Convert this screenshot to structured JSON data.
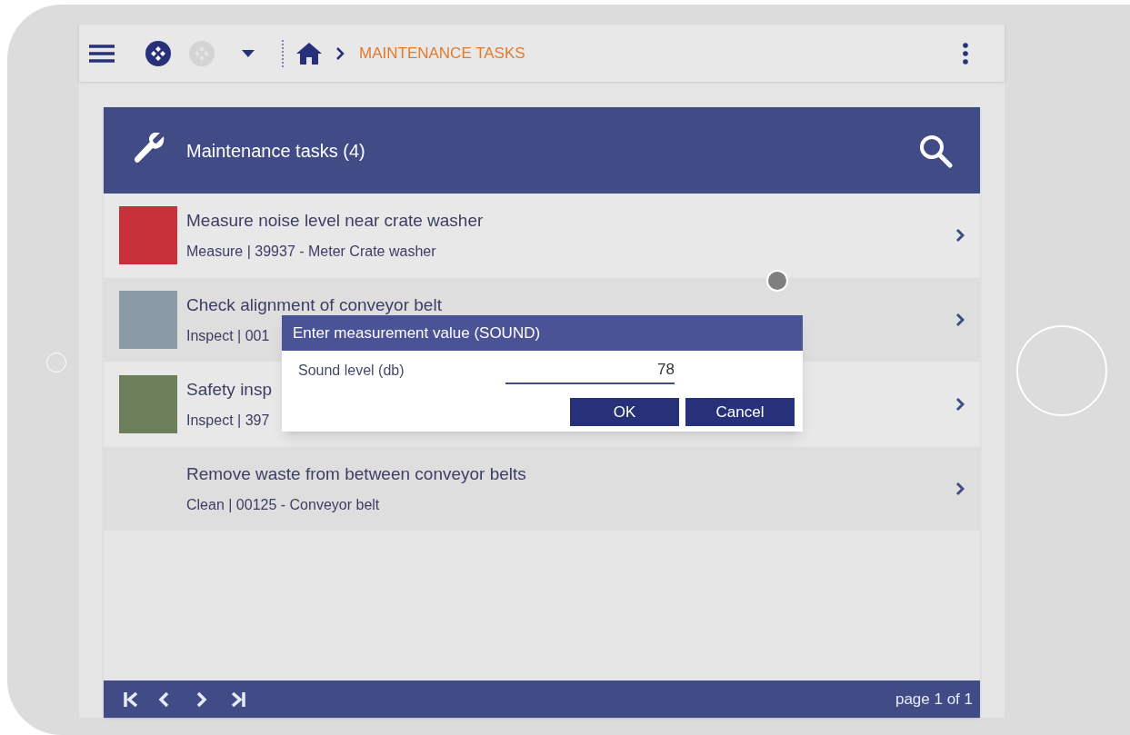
{
  "top_bar": {
    "breadcrumb": [
      {
        "kind": "home"
      },
      {
        "kind": "page",
        "label": "MAINTENANCE TASKS"
      }
    ],
    "apps": [
      {
        "disabled": false
      },
      {
        "disabled": true
      }
    ]
  },
  "list": {
    "title": "Maintenance tasks (4)",
    "tasks": [
      {
        "title": "Measure noise level near crate washer",
        "subtitle": "Measure | 39937 - Meter Crate washer",
        "photo": true
      },
      {
        "title": "Check alignment of conveyor belt",
        "subtitle": "Inspect | 001",
        "photo": true
      },
      {
        "title": "Safety insp",
        "subtitle": "Inspect | 397",
        "photo": true
      },
      {
        "title": "Remove waste from between conveyor belts",
        "subtitle": "Clean | 00125 - Conveyor belt",
        "photo": false
      }
    ],
    "pager": "page 1 of 1"
  },
  "dialog": {
    "title": "Enter measurement value (SOUND)",
    "field_label": "Sound level (db)",
    "value": "78",
    "buttons": [
      "OK",
      "Cancel"
    ]
  }
}
